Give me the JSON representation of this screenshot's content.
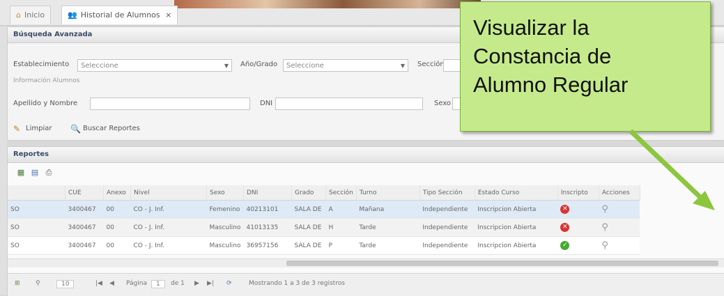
{
  "tabs": [
    {
      "icon": "home-icon",
      "label": "Inicio"
    },
    {
      "icon": "users-icon",
      "label": "Historial de Alumnos",
      "close": "×"
    }
  ],
  "search_panel": {
    "title": "Búsqueda Avanzada",
    "establecimiento_label": "Establecimiento",
    "establecimiento_value": "Seleccione",
    "anio_label": "Año/Grado",
    "anio_value": "Seleccione",
    "seccion_label": "Sección",
    "info_label": "Información Alumnos",
    "apellido_label": "Apellido y Nombre",
    "dni_label": "DNI",
    "sexo_label": "Sexo",
    "limpiar_label": "Limpiar",
    "buscar_label": "Buscar Reportes"
  },
  "reports": {
    "title": "Reportes",
    "columns": [
      "",
      "CUE",
      "Anexo",
      "Nivel",
      "Sexo",
      "DNI",
      "Grado",
      "Sección",
      "Turno",
      "Tipo Sección",
      "Estado Curso",
      "Inscripto",
      "Acciones"
    ],
    "rows": [
      {
        "c0": "SO",
        "cue": "3400467",
        "anexo": "00",
        "nivel": "CO - J. Inf.",
        "sexo": "Femenino",
        "dni": "40213101",
        "grado": "SALA DE",
        "seccion": "A",
        "turno": "Mañana",
        "tipo": "Independiente",
        "estado": "Inscripcion Abierta",
        "inscripto": "no"
      },
      {
        "c0": "SO",
        "cue": "3400467",
        "anexo": "00",
        "nivel": "CO - J. Inf.",
        "sexo": "Masculino",
        "dni": "41013135",
        "grado": "SALA DE",
        "seccion": "H",
        "turno": "Tarde",
        "tipo": "Independiente",
        "estado": "Inscripcion Abierta",
        "inscripto": "no"
      },
      {
        "c0": "SO",
        "cue": "3400467",
        "anexo": "00",
        "nivel": "CO - J. Inf.",
        "sexo": "Masculino",
        "dni": "36957156",
        "grado": "SALA DE",
        "seccion": "P",
        "turno": "Tarde",
        "tipo": "Independiente",
        "estado": "Inscripcion Abierta",
        "inscripto": "yes"
      }
    ]
  },
  "pager": {
    "page_size": "10",
    "page_label": "Página",
    "page_value": "1",
    "of_label": "de 1",
    "showing": "Mostrando 1 a 3 de 3 registros"
  },
  "callout": {
    "line1": "Visualizar la",
    "line2": "Constancia de",
    "line3": "Alumno Regular",
    "color": "#c5ea8c",
    "arrow_color": "#8cc63f"
  }
}
